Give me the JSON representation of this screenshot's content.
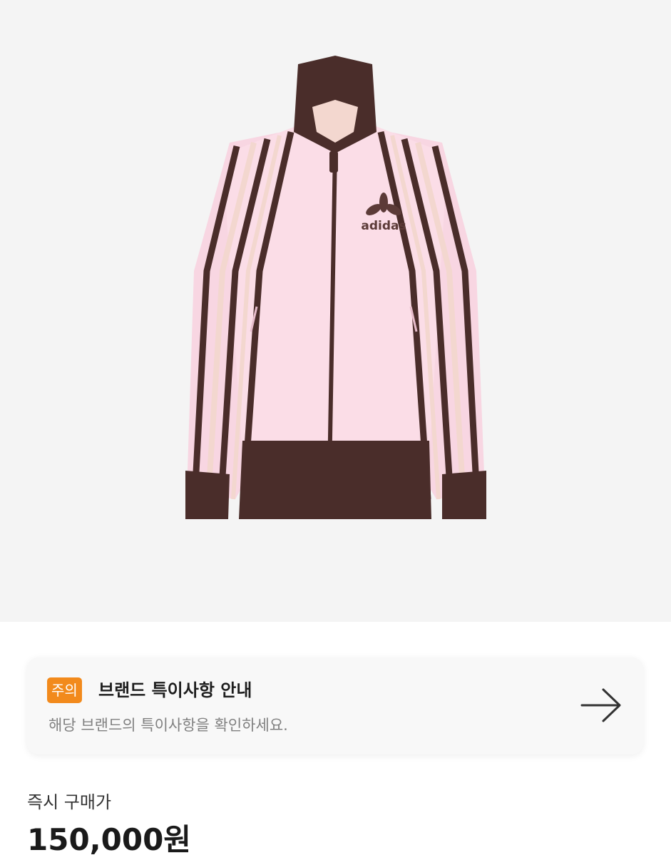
{
  "product": {
    "image_alt": "adidas track jacket",
    "logo_text": "adidas",
    "colors": {
      "body": "#f8d6e2",
      "trim": "#4a2d2a",
      "stripe_light": "#f3d7cf",
      "background": "#f4f4f4"
    }
  },
  "notice": {
    "badge": "주의",
    "title": "브랜드 특이사항 안내",
    "subtitle": "해당 브랜드의 특이사항을 확인하세요.",
    "arrow_icon": "arrow-right-icon",
    "badge_color": "#f28a1c"
  },
  "price": {
    "label": "즉시 구매가",
    "value": "150,000원"
  }
}
